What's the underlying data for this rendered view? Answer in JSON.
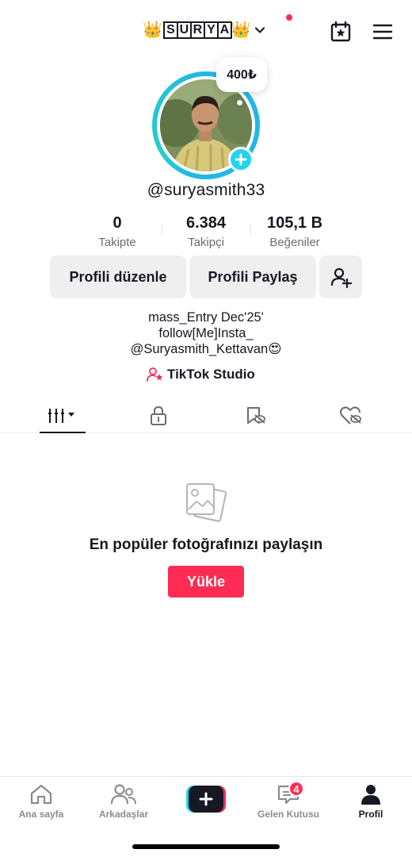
{
  "header": {
    "crown_left": "👑",
    "username_letters": [
      "S",
      "U",
      "R",
      "Y",
      "A"
    ],
    "crown_right": "👑",
    "icons": {
      "switch": "chevron-down-icon",
      "calendar": "calendar-star-icon",
      "menu": "hamburger-menu-icon"
    }
  },
  "profile": {
    "coins_bubble": "400₺",
    "handle": "@suryasmith33",
    "stats": [
      {
        "value": "0",
        "label": "Takipte"
      },
      {
        "value": "6.384",
        "label": "Takipçi"
      },
      {
        "value": "105,1 B",
        "label": "Beğeniler"
      }
    ],
    "buttons": {
      "edit": "Profili düzenle",
      "share": "Profili Paylaş"
    },
    "bio_lines": [
      "mass_Entry Dec'25'",
      "follow[Me]Insta_",
      "@Suryasmith_Kettavan😍"
    ],
    "studio_label": "TikTok Studio"
  },
  "tabs": [
    "videos-grid-icon",
    "lock-icon",
    "bookmark-eye-icon",
    "heart-eye-icon"
  ],
  "empty_state": {
    "title": "En popüler fotoğrafınızı paylaşın",
    "upload_label": "Yükle"
  },
  "bottom_nav": {
    "home": "Ana sayfa",
    "friends": "Arkadaşlar",
    "inbox": "Gelen Kutusu",
    "inbox_badge": "4",
    "profile": "Profil"
  },
  "colors": {
    "accent": "#fe2c55",
    "ring": "#22b8e6",
    "add_badge": "#20d5ec"
  }
}
